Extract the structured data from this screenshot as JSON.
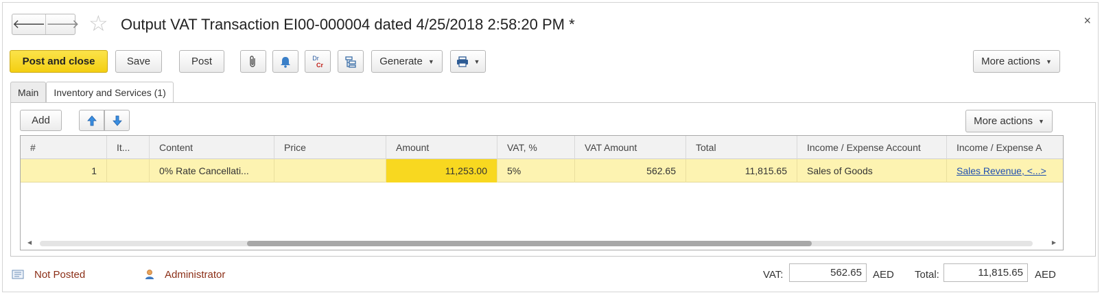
{
  "window": {
    "title": "Output VAT Transaction EI00-000004 dated 4/25/2018 2:58:20 PM *",
    "close_label": "×"
  },
  "nav": {
    "back": "🡐",
    "forward": "🡒"
  },
  "toolbar": {
    "post_and_close": "Post and close",
    "save": "Save",
    "post": "Post",
    "generate": "Generate",
    "more_actions": "More actions",
    "dr": "Dr",
    "cr": "Cr"
  },
  "tabs": [
    {
      "label": "Main"
    },
    {
      "label": "Inventory and Services (1)"
    }
  ],
  "table_toolbar": {
    "add": "Add",
    "more_actions": "More actions"
  },
  "table": {
    "columns": [
      "#",
      "It...",
      "Content",
      "Price",
      "Amount",
      "VAT, %",
      "VAT Amount",
      "Total",
      "Income / Expense Account",
      "Income / Expense A"
    ],
    "rows": [
      {
        "num": "1",
        "item": "",
        "content": "0% Rate Cancellati...",
        "price": "",
        "amount": "11,253.00",
        "vat_rate": "5%",
        "vat_amount": "562.65",
        "total": "11,815.65",
        "account": "Sales of Goods",
        "account2": "Sales Revenue, <...>"
      }
    ]
  },
  "footer": {
    "status": "Not Posted",
    "user": "Administrator",
    "vat_label": "VAT:",
    "vat_value": "562.65",
    "currency": "AED",
    "total_label": "Total:",
    "total_value": "11,815.65",
    "currency2": "AED"
  },
  "colors": {
    "primary_button": "#f4cf12",
    "selected_row": "#fdf3b1",
    "selected_cell": "#f8d820",
    "status_text": "#8b2e16",
    "link": "#1f4fb0"
  }
}
